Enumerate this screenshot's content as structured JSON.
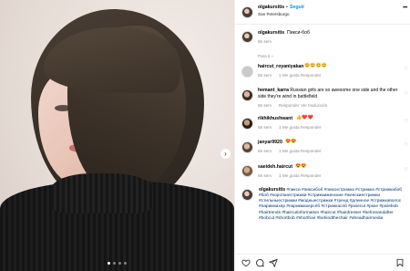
{
  "post": {
    "author": "olgakursitis",
    "follow_label": "Seguir",
    "location": "San Petersburgo",
    "caption_title": "Пикси-боб",
    "caption_time": "56 sem"
  },
  "translation_label": "Para ti",
  "comments": [
    {
      "user": "haircut_royaniyakan",
      "text": "😊😊😊😊",
      "time": "56 sem",
      "likes": "1 Me gusta",
      "reply": "Responder",
      "translate": ""
    },
    {
      "user": "hemant_karra",
      "text": "Russian girls are so awesome one side and the other side they're wind in battlefield",
      "time": "56 sem",
      "likes": "",
      "reply": "Responder",
      "translate": "Ver traducción"
    },
    {
      "user": "rikhikhushwant",
      "text": "👍❤️❤️",
      "time": "56 sem",
      "likes": "1 Me gusta",
      "reply": "Responder",
      "translate": ""
    },
    {
      "user": "janyar9920",
      "text": "😍😍",
      "time": "56 sem",
      "likes": "1 Me gusta",
      "reply": "Responder",
      "translate": ""
    },
    {
      "user": "saeideh.haircut",
      "text": "😍😍",
      "time": "56 sem",
      "likes": "1 Me gusta",
      "reply": "Responder",
      "translate": ""
    }
  ],
  "caption_block": {
    "user": "olgakursitis",
    "hashtags": "#пикси #пиксибоб #пикси­стрижка #стрижка #стрижкабоб #боб #короткиестрижки #стрижкиженские #женскиестрижки #стильныестрижки #модныестрижки #тренд #длинное #стрижкаволос #парикмахер #парикмахерспб #стрижкаспб #pixiecut #pixie #pixiebob #hairtrends #haircutinformation #haircut #hairdresser #beforeandafter #bobcut #shortbob #shorthair #behindthechair #aheadhairmedia"
  },
  "icons": {
    "more": "more-horizontal-icon",
    "next": "chevron-right-icon",
    "like": "heart-icon",
    "comment": "comment-icon",
    "share": "paper-plane-icon",
    "save": "bookmark-icon"
  },
  "colors": {
    "accent": "#0095f6",
    "hashtag": "#00376b",
    "muted": "#8e8e8e"
  },
  "carousel": {
    "slides": 4,
    "active_slide": 1
  }
}
